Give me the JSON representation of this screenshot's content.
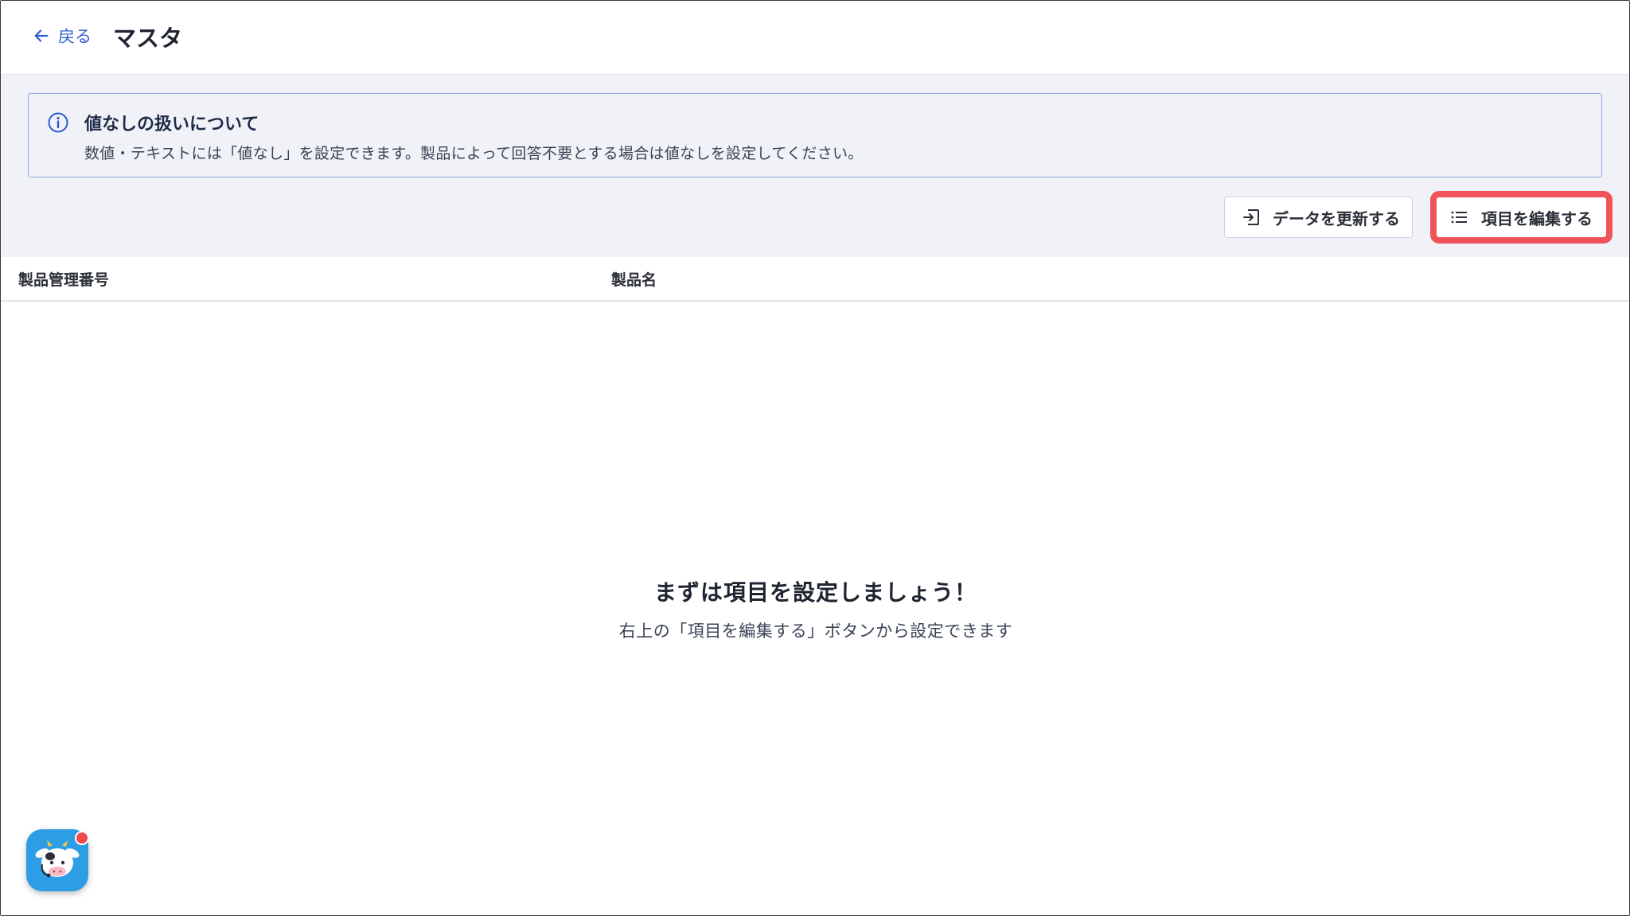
{
  "header": {
    "back_label": "戻る",
    "title": "マスタ"
  },
  "info": {
    "title": "値なしの扱いについて",
    "body": "数値・テキストには「値なし」を設定できます。製品によって回答不要とする場合は値なしを設定してください。"
  },
  "toolbar": {
    "update_label": "データを更新する",
    "edit_label": "項目を編集する"
  },
  "table": {
    "columns": [
      "製品管理番号",
      "製品名"
    ]
  },
  "empty": {
    "title": "まずは項目を設定しましょう！",
    "body": "右上の「項目を編集する」ボタンから設定できます"
  },
  "colors": {
    "accent": "#2f5dd0",
    "info_border": "#8fa9e8",
    "highlight": "#f0545a",
    "chat_bg": "#2d9ee6"
  }
}
